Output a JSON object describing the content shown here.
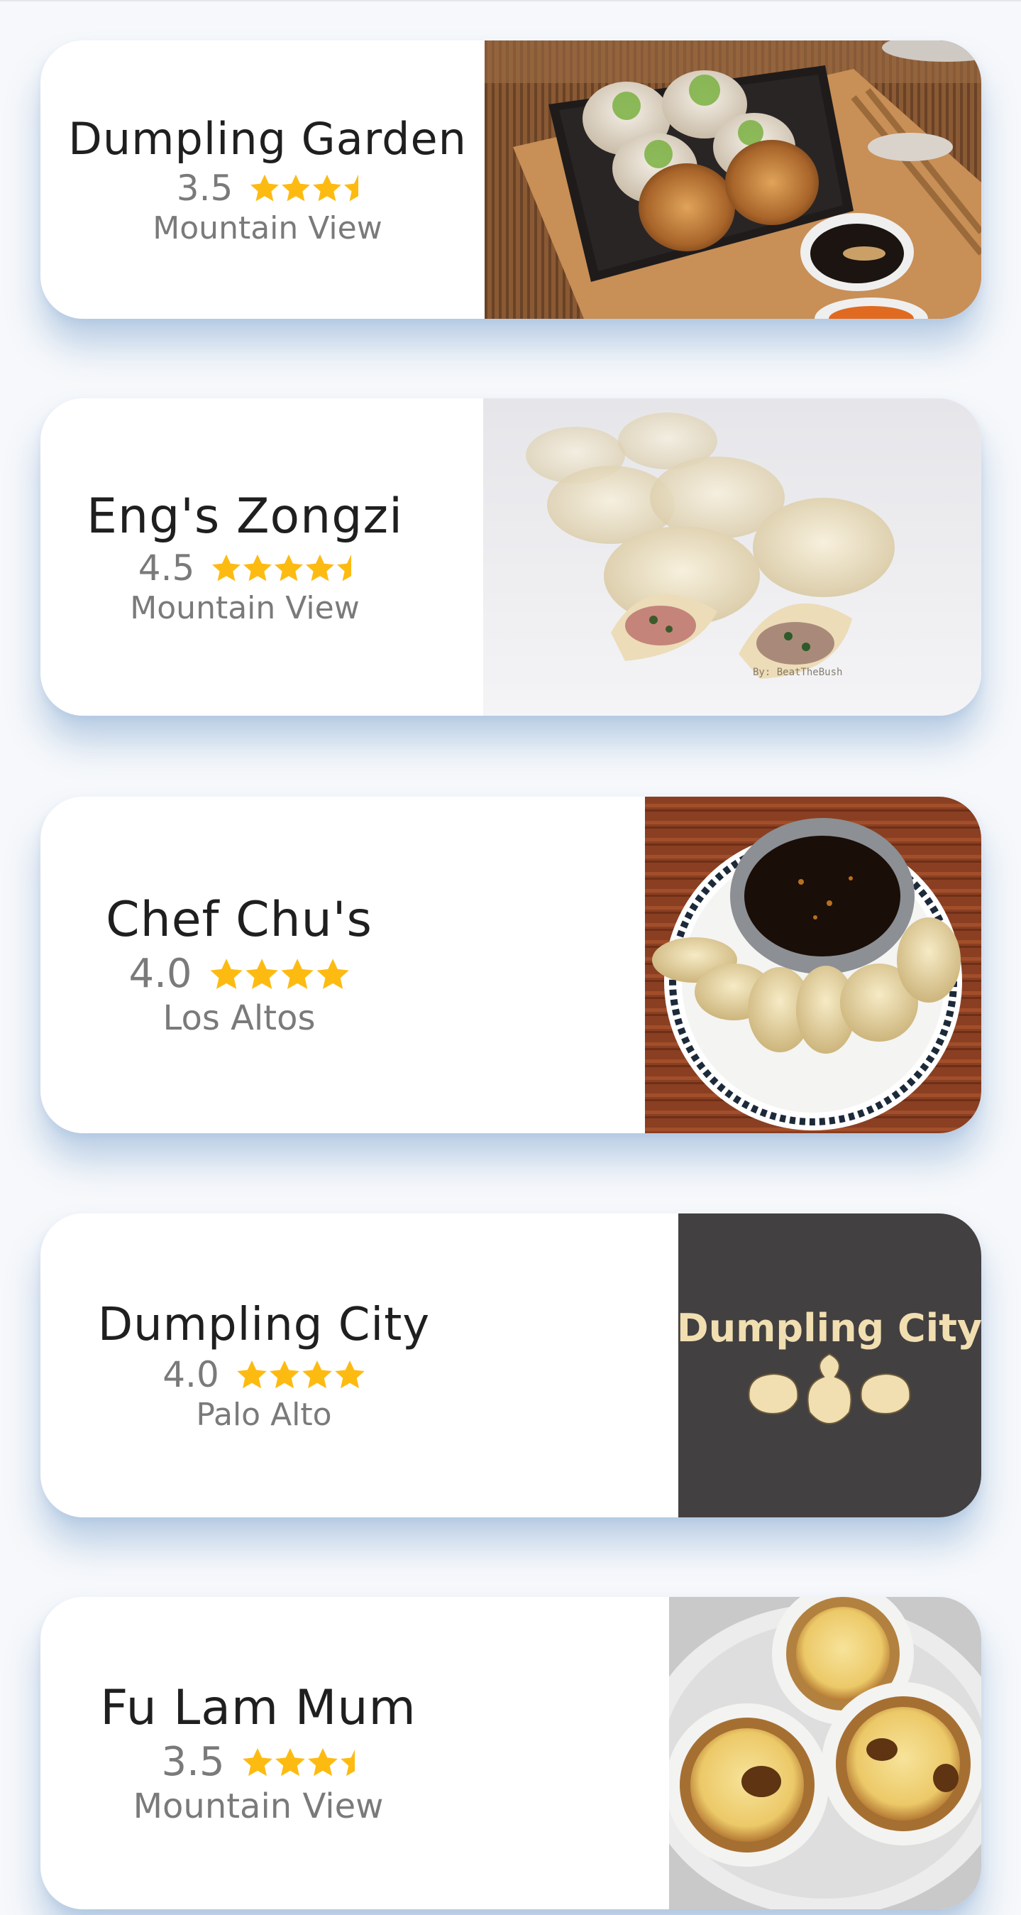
{
  "restaurants": [
    {
      "name": "Dumpling Garden",
      "rating": "3.5",
      "rating_value": 3.5,
      "city": "Mountain View",
      "photo": "pan-fried-buns-photo"
    },
    {
      "name": "Eng's Zongzi",
      "rating": "4.5",
      "rating_value": 4.5,
      "city": "Mountain View",
      "photo": "dumplings-photo"
    },
    {
      "name": "Chef Chu's",
      "rating": "4.0",
      "rating_value": 4.0,
      "city": "Los Altos",
      "photo": "dumplings-dipping-sauce-photo"
    },
    {
      "name": "Dumpling City",
      "rating": "4.0",
      "rating_value": 4.0,
      "city": "Palo Alto",
      "photo": "dumpling-city-logo",
      "logo_text": "Dumpling City"
    },
    {
      "name": "Fu Lam Mum",
      "rating": "3.5",
      "rating_value": 3.5,
      "city": "Mountain View",
      "photo": "egg-tarts-photo"
    }
  ],
  "colors": {
    "star": "#fdbb12",
    "text_primary": "#1f1f1f",
    "text_secondary": "#7a7a7a",
    "logo_bg": "#434041",
    "logo_text": "#f1dfb1"
  }
}
